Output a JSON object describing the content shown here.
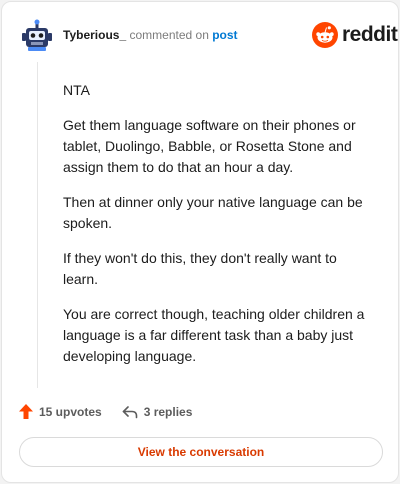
{
  "header": {
    "username": "Tyberious_",
    "commented_on": "commented on",
    "post_link": "post",
    "logo_text": "reddit",
    "avatar_icon": "robot-avatar-icon",
    "logo_icon": "reddit-snoo-icon"
  },
  "comment": {
    "paragraphs": [
      "NTA",
      "Get them language software on their phones or tablet, Duolingo, Babble, or Rosetta Stone and assign them to do that an hour a day.",
      "Then at dinner only your native language can be spoken.",
      "If they won't do this, they don't really want to learn.",
      "You are correct though, teaching older children a language is a far different task than a baby just developing language."
    ]
  },
  "actions": {
    "upvotes": "15 upvotes",
    "replies": "3 replies",
    "upvote_icon": "upvote-arrow-icon",
    "reply_icon": "reply-arrow-icon"
  },
  "cta": {
    "label": "View the conversation"
  },
  "colors": {
    "accent": "#d93a00",
    "reddit_orange": "#ff4500",
    "link_blue": "#0079d3",
    "text": "#1c1c1c",
    "muted": "#7c7c7c"
  }
}
